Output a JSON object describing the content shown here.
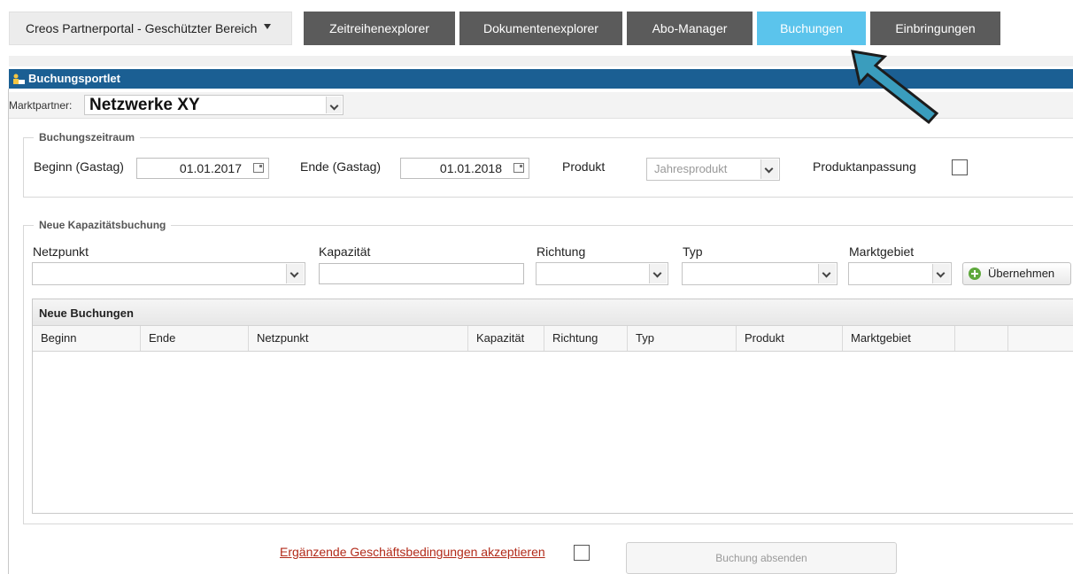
{
  "header": {
    "site_title": "Creos Partnerportal - Geschützter Bereich",
    "tabs": [
      {
        "label": "Zeitreihenexplorer",
        "active": false
      },
      {
        "label": "Dokumentenexplorer",
        "active": false
      },
      {
        "label": "Abo-Manager",
        "active": false
      },
      {
        "label": "Buchungen",
        "active": true
      },
      {
        "label": "Einbringungen",
        "active": false
      }
    ]
  },
  "portlet": {
    "title": "Buchungsportlet",
    "marktpartner_label": "Marktpartner:",
    "marktpartner_value": "Netzwerke XY"
  },
  "buchungszeitraum": {
    "legend": "Buchungszeitraum",
    "beginn_label": "Beginn (Gastag)",
    "beginn_value": "01.01.2017",
    "ende_label": "Ende (Gastag)",
    "ende_value": "01.01.2018",
    "produkt_label": "Produkt",
    "produkt_value": "Jahresprodukt",
    "anpassung_label": "Produktanpassung",
    "anpassung_checked": false
  },
  "kapazitaetsbuchung": {
    "legend": "Neue Kapazitätsbuchung",
    "netzpunkt_label": "Netzpunkt",
    "kapazitaet_label": "Kapazität",
    "richtung_label": "Richtung",
    "typ_label": "Typ",
    "marktgebiet_label": "Marktgebiet",
    "uebernehmen_label": "Übernehmen"
  },
  "grid": {
    "title": "Neue Buchungen",
    "columns": [
      "Beginn",
      "Ende",
      "Netzpunkt",
      "Kapazität",
      "Richtung",
      "Typ",
      "Produkt",
      "Marktgebiet",
      "",
      ""
    ],
    "rows": []
  },
  "footer": {
    "terms_label": "Ergänzende Geschäftsbedingungen akzeptieren",
    "terms_checked": false,
    "submit_label": "Buchung absenden"
  },
  "colors": {
    "active_tab": "#5bc4ec",
    "inactive_tab": "#5b5b5b",
    "portlet_header": "#1b5f93",
    "link": "#b22a19",
    "arrow": "#3a9dbd"
  }
}
